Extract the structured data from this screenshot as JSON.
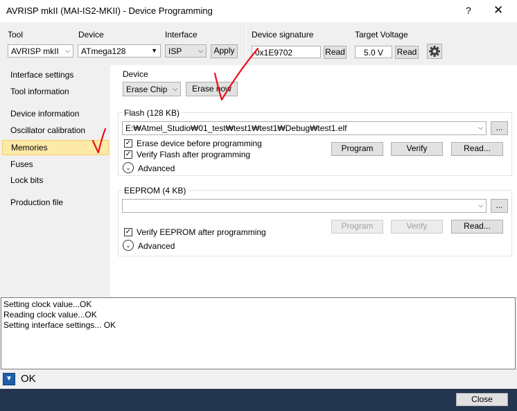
{
  "window": {
    "title": "AVRISP mkII (MAI-IS2-MKII) - Device Programming",
    "help_glyph": "?",
    "close_glyph": "✕"
  },
  "toolbar": {
    "tool_label": "Tool",
    "tool_value": "AVRISP mkII",
    "device_label": "Device",
    "device_value": "ATmega128",
    "interface_label": "Interface",
    "interface_value": "ISP",
    "apply_label": "Apply",
    "signature_label": "Device signature",
    "signature_value": "0x1E9702",
    "signature_read_label": "Read",
    "voltage_label": "Target Voltage",
    "voltage_value": "5.0 V",
    "voltage_read_label": "Read",
    "settings_icon": "gear-icon"
  },
  "sidebar": {
    "items": [
      {
        "label": "Interface settings",
        "active": false
      },
      {
        "label": "Tool information",
        "active": false
      },
      {
        "label": "Device information",
        "active": false
      },
      {
        "label": "Oscillator calibration",
        "active": false
      },
      {
        "label": "Memories",
        "active": true
      },
      {
        "label": "Fuses",
        "active": false
      },
      {
        "label": "Lock bits",
        "active": false
      },
      {
        "label": "Production file",
        "active": false
      }
    ]
  },
  "device_section": {
    "label": "Device",
    "action_value": "Erase Chip",
    "erase_now_label": "Erase now"
  },
  "flash_section": {
    "label": "Flash (128 KB)",
    "file_path": "E:₩Atmel_Studio₩01_test₩test1₩test1₩Debug₩test1.elf",
    "browse_label": "...",
    "erase_before_label": "Erase device before programming",
    "erase_before_checked": true,
    "verify_label": "Verify Flash after programming",
    "verify_checked": true,
    "advanced_label": "Advanced",
    "program_label": "Program",
    "verify_button_label": "Verify",
    "read_label": "Read..."
  },
  "eeprom_section": {
    "label": "EEPROM (4 KB)",
    "file_path": "",
    "browse_label": "...",
    "verify_label": "Verify EEPROM after programming",
    "verify_checked": true,
    "advanced_label": "Advanced",
    "program_label": "Program",
    "verify_button_label": "Verify",
    "read_label": "Read..."
  },
  "log": {
    "lines": [
      "Setting clock value...OK",
      "Reading clock value...OK",
      "Setting interface settings... OK"
    ]
  },
  "status": {
    "text": "OK"
  },
  "footer": {
    "close_label": "Close"
  },
  "colors": {
    "annotation": "#e8101a",
    "active_nav": "#fde9a8",
    "footer_bg": "#243550"
  }
}
